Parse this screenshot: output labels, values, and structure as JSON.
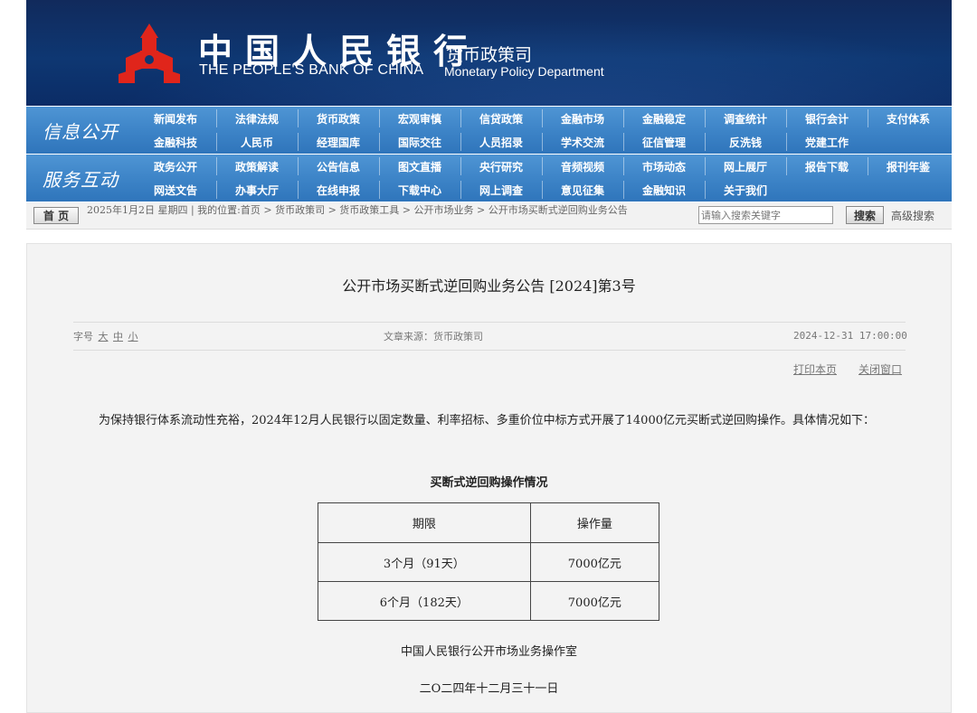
{
  "header": {
    "bank_name_cn": "中国人民银行",
    "bank_name_en": "THE PEOPLE'S BANK OF CHINA",
    "dept_cn": "货币政策司",
    "dept_en": "Monetary Policy Department",
    "brand_color": "#0e3772",
    "logo_color": "#e0251b"
  },
  "nav": {
    "row1_title": "信息公开",
    "row2_title": "服务互动",
    "row1_items": [
      "新闻发布",
      "法律法规",
      "货币政策",
      "宏观审慎",
      "信贷政策",
      "金融市场",
      "金融稳定",
      "调查统计",
      "银行会计",
      "支付体系",
      "金融科技",
      "人民币",
      "经理国库",
      "国际交往",
      "人员招录",
      "学术交流",
      "征信管理",
      "反洗钱",
      "党建工作"
    ],
    "row2_items": [
      "政务公开",
      "政策解读",
      "公告信息",
      "图文直播",
      "央行研究",
      "音频视频",
      "市场动态",
      "网上展厅",
      "报告下载",
      "报刊年鉴",
      "网送文告",
      "办事大厅",
      "在线申报",
      "下载中心",
      "网上调查",
      "意见征集",
      "金融知识",
      "关于我们"
    ]
  },
  "crumbbar": {
    "home_label": "首 页",
    "date_line": "2025年1月2日 星期四 | 我的位置:首页 > 货币政策司 > 货币政策工具 > 公开市场业务 > 公开市场买断式逆回购业务公告",
    "search_placeholder": "请输入搜索关键字",
    "search_button": "搜索",
    "advanced_search": "高级搜索"
  },
  "article": {
    "title": "公开市场买断式逆回购业务公告 [2024]第3号",
    "font_size_label": "字号",
    "font_large": "大",
    "font_medium": "中",
    "font_small": "小",
    "source": "文章来源：货币政策司",
    "datetime": "2024-12-31 17:00:00",
    "print": "打印本页",
    "close": "关闭窗口",
    "body": "为保持银行体系流动性充裕，2024年12月人民银行以固定数量、利率招标、多重价位中标方式开展了14000亿元买断式逆回购操作。具体情况如下：",
    "table_caption": "买断式逆回购操作情况",
    "table_headers": [
      "期限",
      "操作量"
    ],
    "table_rows": [
      [
        "3个月（91天）",
        "7000亿元"
      ],
      [
        "6个月（182天）",
        "7000亿元"
      ]
    ],
    "signature_org": "中国人民银行公开市场业务操作室",
    "signature_date": "二O二四年十二月三十一日"
  }
}
